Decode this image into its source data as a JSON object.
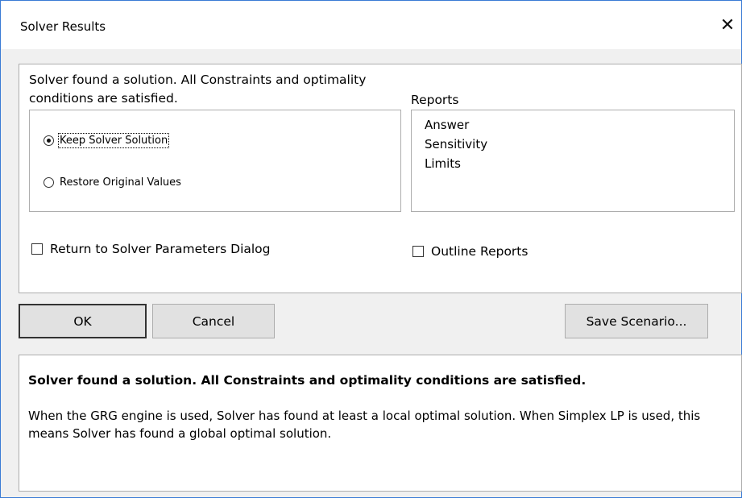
{
  "window": {
    "title": "Solver Results"
  },
  "status": {
    "message_line1": "Solver found a solution.  All Constraints and optimality",
    "message_line2": "conditions are satisfied."
  },
  "options": {
    "keep_label": "Keep Solver Solution",
    "restore_label": "Restore Original Values",
    "selected": "keep"
  },
  "reports": {
    "label": "Reports",
    "items": [
      "Answer",
      "Sensitivity",
      "Limits"
    ]
  },
  "checks": {
    "return_label": "Return to Solver Parameters Dialog",
    "outline_label": "Outline Reports"
  },
  "buttons": {
    "ok": "OK",
    "cancel": "Cancel",
    "save": "Save Scenario..."
  },
  "description": {
    "title": "Solver found a solution.  All Constraints and optimality conditions are satisfied.",
    "body": "When the GRG engine is used, Solver has found at least a local optimal solution. When Simplex LP is used, this means Solver has found a global optimal solution."
  }
}
